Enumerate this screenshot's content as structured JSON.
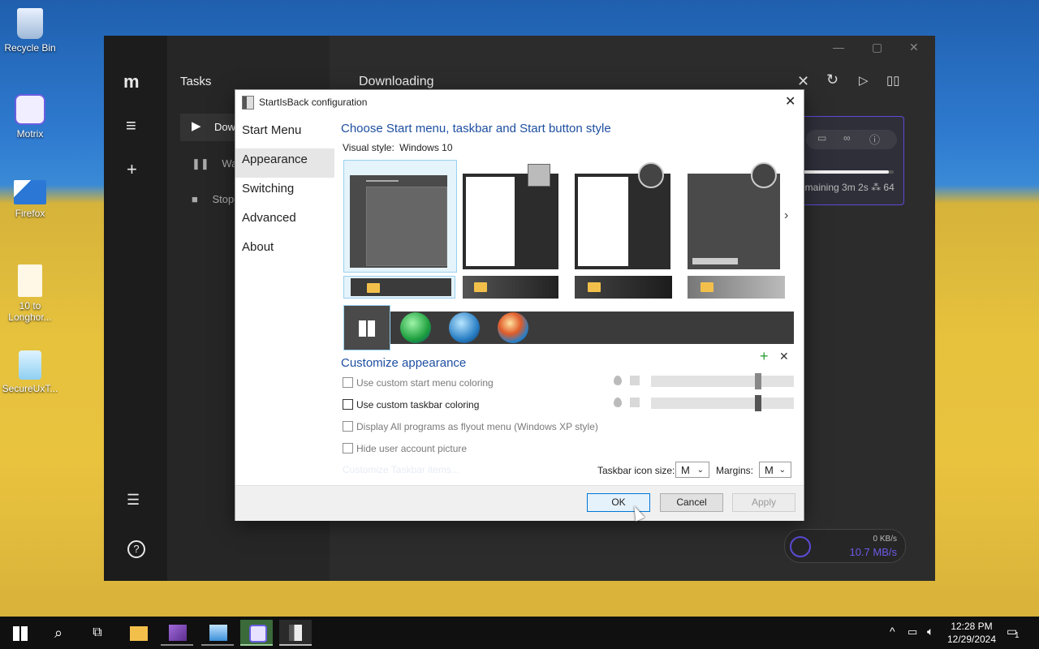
{
  "desktop": {
    "icons": [
      {
        "label": "Recycle Bin"
      },
      {
        "label": "Motrix"
      },
      {
        "label": "Firefox"
      },
      {
        "label": "10 to Longhor..."
      },
      {
        "label": "SecureUxT..."
      }
    ]
  },
  "motrix": {
    "sidebar_title": "Tasks",
    "sidebar_items": [
      "Dow",
      "Wai",
      "Stop"
    ],
    "main_title": "Downloading",
    "card": {
      "remaining": "emaining 3m 2s",
      "connections": "64",
      "progress": 0.95
    },
    "speed": {
      "upload": "0 KB/s",
      "download": "10.7 MB/s"
    }
  },
  "dialog": {
    "title": "StartIsBack configuration",
    "nav": [
      "Start Menu",
      "Appearance",
      "Switching",
      "Advanced",
      "About"
    ],
    "selected_nav": "Appearance",
    "heading": "Choose Start menu, taskbar and Start button style",
    "visual_style_label": "Visual style:",
    "visual_style_value": "Windows 10",
    "customize_heading": "Customize appearance",
    "options": [
      {
        "label": "Use custom start menu coloring",
        "checked": false,
        "enabled": false
      },
      {
        "label": "Use custom taskbar coloring",
        "checked": false,
        "enabled": true
      },
      {
        "label": "Display All programs as flyout menu (Windows XP style)",
        "checked": false,
        "enabled": false
      },
      {
        "label": "Hide user account picture",
        "checked": false,
        "enabled": false
      }
    ],
    "customize_link": "Customize Taskbar items...",
    "icon_size_label": "Taskbar icon size:",
    "icon_size_value": "M",
    "margins_label": "Margins:",
    "margins_value": "M",
    "ok": "OK",
    "cancel": "Cancel",
    "apply": "Apply"
  },
  "taskbar": {
    "time": "12:28 PM",
    "date": "12/29/2024",
    "notifications": "1"
  },
  "colors": {
    "accent": "#0078d7",
    "heading_blue": "#1e4fa0",
    "motrix_purple": "#5b4bd6"
  }
}
